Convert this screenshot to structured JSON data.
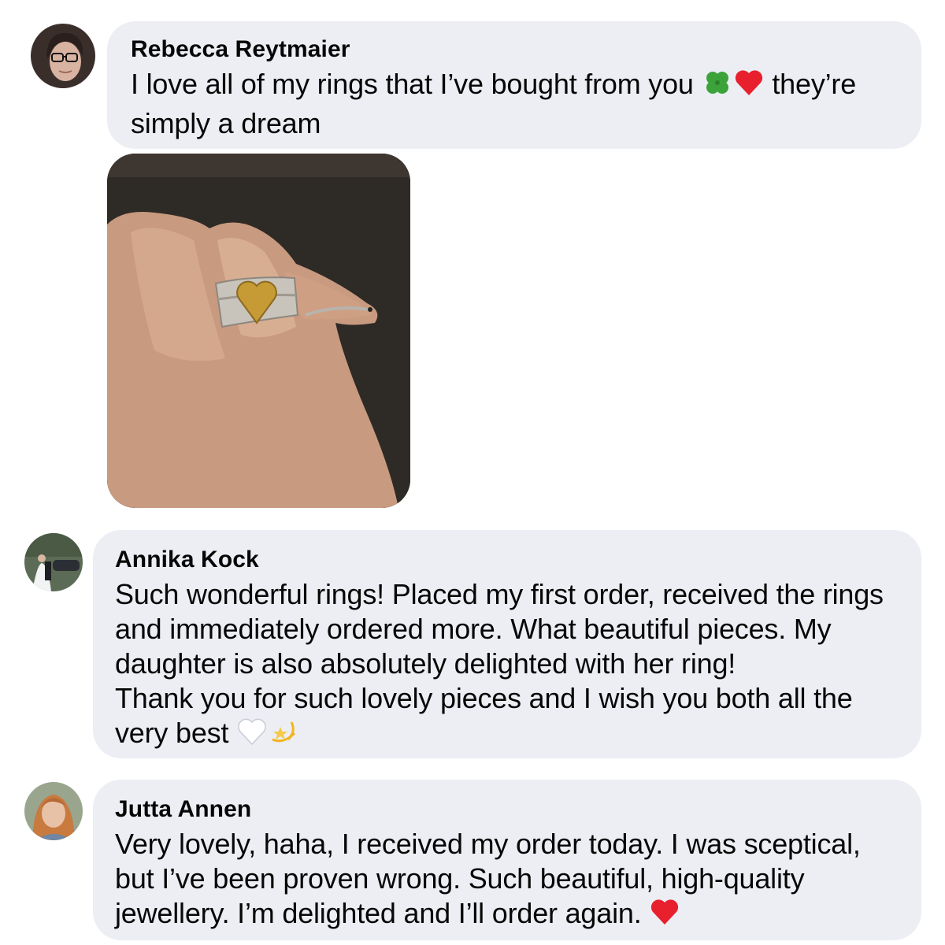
{
  "comments": [
    {
      "author": "Rebecca Reytmaier",
      "lines": [
        "I love all of my rings that I’ve bought from you",
        "they’re",
        "simply a dream"
      ],
      "emojis": [
        "four-leaf-clover",
        "red-heart"
      ],
      "image": "hand-with-heart-rings-photo"
    },
    {
      "author": "Annika Kock",
      "lines": [
        "Such wonderful rings! Placed my first order, received the rings",
        "and immediately ordered more. What beautiful pieces. My",
        "daughter is also absolutely delighted with her ring!",
        "Thank you for such lovely pieces and I wish you both all the",
        "very best"
      ],
      "emojis": [
        "white-heart",
        "dizzy-star"
      ]
    },
    {
      "author": "Jutta Annen",
      "lines": [
        "Very lovely, haha, I received my order today. I was sceptical,",
        "but I’ve been proven wrong. Such beautiful, high-quality",
        "jewellery. I’m delighted and I’ll order again."
      ],
      "emojis": [
        "red-heart"
      ]
    }
  ],
  "colors": {
    "bubble": "#eceef3",
    "text": "#070707",
    "heart": "#e8202e",
    "clover": "#3ca33a"
  }
}
